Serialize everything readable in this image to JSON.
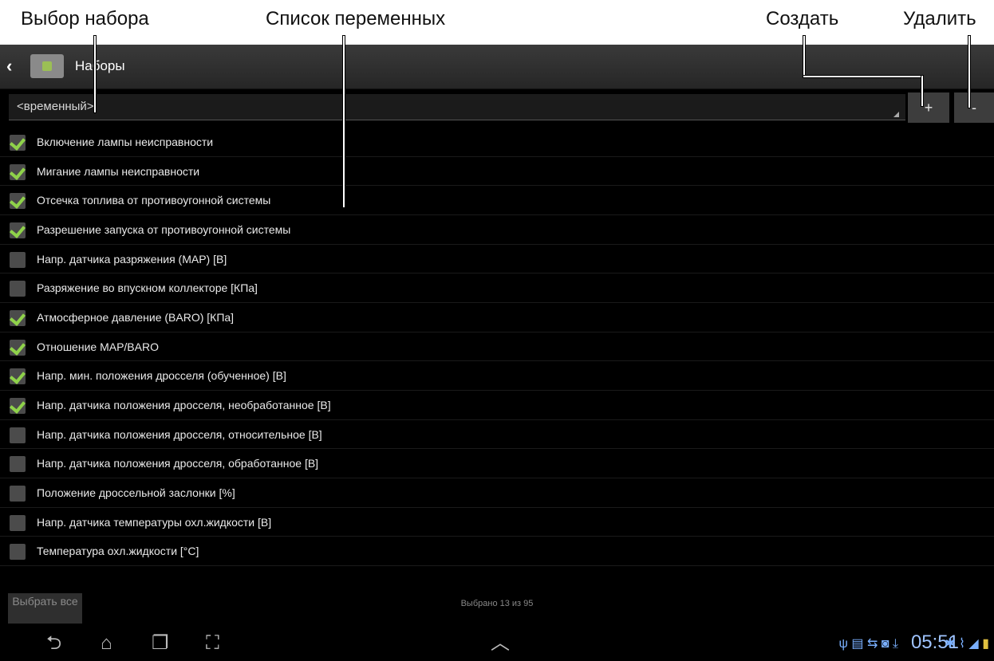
{
  "callouts": {
    "set_select": "Выбор набора",
    "var_list": "Список переменных",
    "create": "Создать",
    "delete": "Удалить"
  },
  "actionbar": {
    "title": "Наборы",
    "back_icon": "chevron-left-icon",
    "app_icon": "device-icon"
  },
  "set_select": {
    "value": "<временный>"
  },
  "buttons": {
    "create": "+",
    "delete": "-",
    "select_all": "Выбрать все"
  },
  "variables": [
    {
      "label": "Включение лампы неисправности",
      "checked": true
    },
    {
      "label": "Мигание лампы неисправности",
      "checked": true
    },
    {
      "label": "Отсечка топлива от противоугонной системы",
      "checked": true
    },
    {
      "label": "Разрешение запуска от противоугонной системы",
      "checked": true
    },
    {
      "label": "Напр. датчика разряжения (MAP) [В]",
      "checked": false
    },
    {
      "label": "Разряжение во впускном коллекторе [КПа]",
      "checked": false
    },
    {
      "label": "Атмосферное давление (BARO) [КПа]",
      "checked": true
    },
    {
      "label": "Отношение MAP/BARO",
      "checked": true
    },
    {
      "label": "Напр. мин. положения дросселя (обученное) [В]",
      "checked": true
    },
    {
      "label": "Напр. датчика положения дросселя, необработанное [В]",
      "checked": true
    },
    {
      "label": "Напр. датчика положения дросселя, относительное [В]",
      "checked": false
    },
    {
      "label": "Напр. датчика положения дросселя, обработанное [В]",
      "checked": false
    },
    {
      "label": "Положение дроссельной заслонки [%]",
      "checked": false
    },
    {
      "label": "Напр. датчика температуры охл.жидкости [В]",
      "checked": false
    },
    {
      "label": "Температура охл.жидкости [°C]",
      "checked": false
    }
  ],
  "footer": {
    "selected_count": "Выбрано 13 из 95"
  },
  "statusbar": {
    "time": "05:51",
    "icons": [
      "usb-icon",
      "sd-card-icon",
      "sync-icon",
      "app-notification-icon",
      "download-icon",
      "bluetooth-icon",
      "wifi-icon",
      "signal-icon",
      "battery-icon"
    ]
  },
  "navbar": {
    "icons": [
      "back-icon",
      "home-icon",
      "recent-apps-icon",
      "screenshot-icon",
      "up-chevron-icon"
    ]
  }
}
